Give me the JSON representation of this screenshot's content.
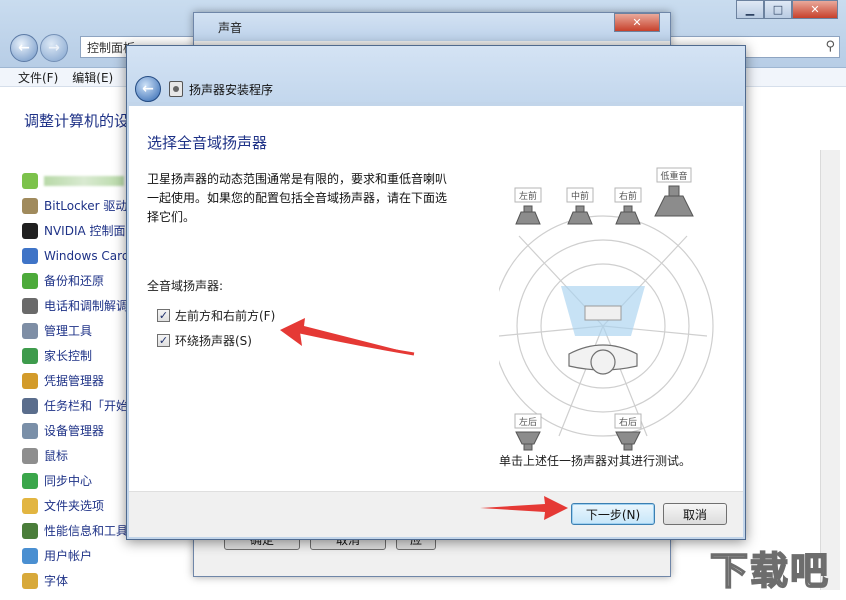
{
  "control_panel": {
    "address_text": "控制面板",
    "menu": [
      "文件(F)",
      "编辑(E)"
    ],
    "heading": "调整计算机的设",
    "items": [
      {
        "label": "",
        "icon": "blurred-icon",
        "color": "#7cc24b"
      },
      {
        "label": "BitLocker 驱动",
        "icon": "bitlocker-icon",
        "color": "#a08a5c"
      },
      {
        "label": "NVIDIA 控制面",
        "icon": "nvidia-icon",
        "color": "#1f1f1f"
      },
      {
        "label": "Windows Card",
        "icon": "cardspace-icon",
        "color": "#3f74c7"
      },
      {
        "label": "备份和还原",
        "icon": "backup-icon",
        "color": "#4caa3a"
      },
      {
        "label": "电话和调制解调",
        "icon": "phone-icon",
        "color": "#6a6a6a"
      },
      {
        "label": "管理工具",
        "icon": "tools-icon",
        "color": "#7e8ea5"
      },
      {
        "label": "家长控制",
        "icon": "parental-icon",
        "color": "#3e9b4c"
      },
      {
        "label": "凭据管理器",
        "icon": "credential-icon",
        "color": "#d39b2a"
      },
      {
        "label": "任务栏和「开始",
        "icon": "taskbar-icon",
        "color": "#5a6d8c"
      },
      {
        "label": "设备管理器",
        "icon": "device-icon",
        "color": "#7a8fa8"
      },
      {
        "label": "鼠标",
        "icon": "mouse-icon",
        "color": "#8e8e8e"
      },
      {
        "label": "同步中心",
        "icon": "sync-icon",
        "color": "#3aa64a"
      },
      {
        "label": "文件夹选项",
        "icon": "folder-icon",
        "color": "#e2b541"
      },
      {
        "label": "性能信息和工具",
        "icon": "performance-icon",
        "color": "#4a7d3a"
      },
      {
        "label": "用户帐户",
        "icon": "user-icon",
        "color": "#4a8fd1"
      },
      {
        "label": "字体",
        "icon": "font-icon",
        "color": "#d8a93a"
      }
    ]
  },
  "sound_dialog": {
    "title": "声音",
    "ok_label": "确定",
    "cancel_label": "取消",
    "apply_label": "应"
  },
  "setup_dialog": {
    "title": "扬声器安装程序",
    "heading": "选择全音域扬声器",
    "description": "卫星扬声器的动态范围通常是有限的，要求和重低音喇叭一起使用。如果您的配置包括全音域扬声器，请在下面选择它们。",
    "group_label": "全音域扬声器:",
    "checkboxes": [
      {
        "label": "左前方和右前方(F)",
        "checked": true
      },
      {
        "label": "环绕扬声器(S)",
        "checked": true
      }
    ],
    "speakers": {
      "front_left": "左前",
      "center": "中前",
      "front_right": "右前",
      "subwoofer": "低重音",
      "rear_left": "左后",
      "rear_right": "右后"
    },
    "test_hint": "单击上述任一扬声器对其进行测试。",
    "next_label": "下一步(N)",
    "cancel_label": "取消"
  },
  "watermark": "下载吧"
}
